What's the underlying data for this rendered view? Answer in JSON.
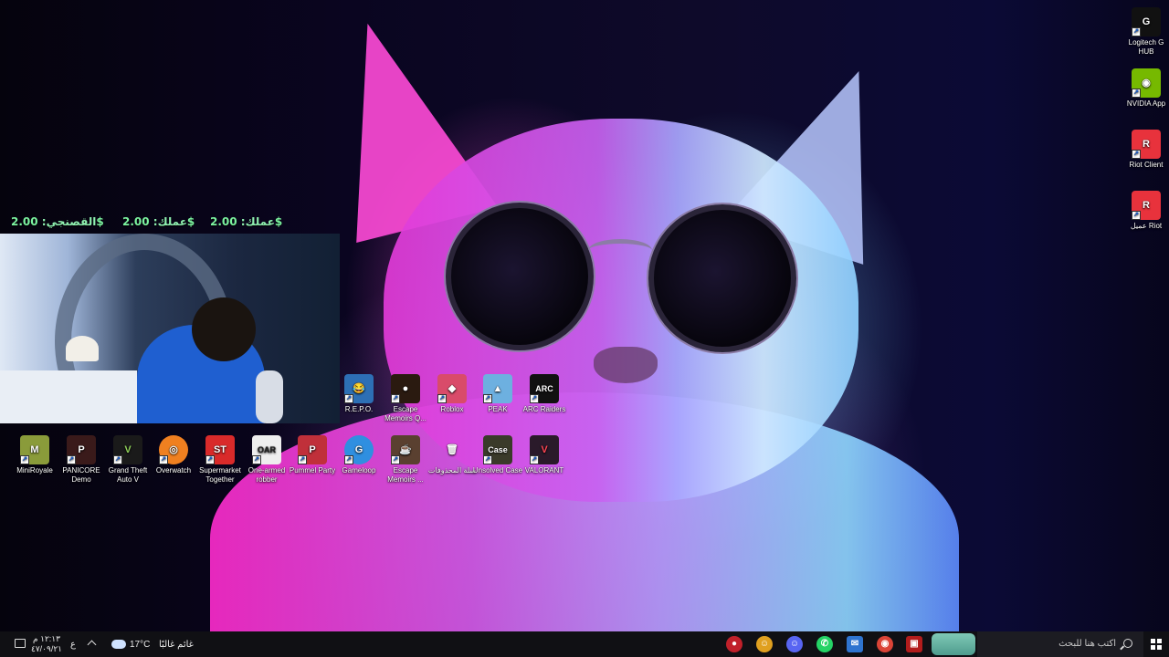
{
  "donations": [
    {
      "label": "عملك:",
      "amount": "2.00$"
    },
    {
      "label": "عملك:",
      "amount": "2.00$"
    },
    {
      "label": "القصنجي:",
      "amount": "2.00$"
    }
  ],
  "right_icons": [
    {
      "label": "Logitech G HUB",
      "icon": "logitech-icon",
      "color": "#111111"
    },
    {
      "label": "NVIDIA App",
      "icon": "nvidia-icon",
      "color": "#76b900"
    },
    {
      "label": "Riot Client",
      "icon": "riot-icon",
      "color": "#e8323c"
    },
    {
      "label": "عميل Riot",
      "icon": "riot-icon",
      "color": "#e8323c"
    }
  ],
  "icons_row1": [
    {
      "label": "R.E.P.O.",
      "glyph": "😂",
      "color": "#2d6fb5"
    },
    {
      "label": "Escape Memoirs Q...",
      "glyph": "●",
      "color": "#2a1a10"
    },
    {
      "label": "Roblox",
      "glyph": "◆",
      "color": "#d94b6a"
    },
    {
      "label": "PEAK",
      "glyph": "▲",
      "color": "#6db0e0"
    },
    {
      "label": "ARC Raiders",
      "glyph": "ARC",
      "color": "#111111"
    }
  ],
  "icons_row2": [
    {
      "label": "MiniRoyale",
      "glyph": "M",
      "color": "#8a9b3a"
    },
    {
      "label": "PANICORE Demo",
      "glyph": "P",
      "color": "#3a1a1a"
    },
    {
      "label": "Grand Theft Auto V",
      "glyph": "V",
      "color": "#1a1a1a"
    },
    {
      "label": "Overwatch",
      "glyph": "◎",
      "color": "#f08020"
    },
    {
      "label": "Supermarket Together",
      "glyph": "ST",
      "color": "#d92a2a"
    },
    {
      "label": "One-armed robber",
      "glyph": "OAR",
      "color": "#eeeeee"
    },
    {
      "label": "Pummel Party",
      "glyph": "P",
      "color": "#c0303a"
    },
    {
      "label": "Gameloop",
      "glyph": "G",
      "color": "#2f8fe0"
    },
    {
      "label": "Escape Memoirs ...",
      "glyph": "☕",
      "color": "#5a4030"
    },
    {
      "label": "سلة المحذوفات",
      "glyph": "🗑",
      "color": "#5aa0e0"
    },
    {
      "label": "Unsolved Case",
      "glyph": "Case",
      "color": "#3a3a2a"
    },
    {
      "label": "VALORANT",
      "glyph": "V",
      "color": "#2a1a2a"
    }
  ],
  "taskbar": {
    "search_placeholder": "اكتب هنا للبحث",
    "weather_temp": "17°C",
    "weather_desc": "غائم غالبًا",
    "lang": "ع",
    "time": "١٢:١٣ م",
    "date": "٤٧/٠٩/٢١",
    "apps": [
      {
        "name": "app-red-icon",
        "color": "#c0202a",
        "glyph": "●"
      },
      {
        "name": "discord-orange-icon",
        "color": "#e0a020",
        "glyph": "☺"
      },
      {
        "name": "discord-icon",
        "color": "#5865f2",
        "glyph": "☺"
      },
      {
        "name": "whatsapp-icon",
        "color": "#25d366",
        "glyph": "✆"
      },
      {
        "name": "mail-icon",
        "color": "#2f74d0",
        "glyph": "✉"
      },
      {
        "name": "chrome-icon",
        "color": "#db4437",
        "glyph": "◉"
      },
      {
        "name": "app-box-icon",
        "color": "#b21c1c",
        "glyph": "▣"
      }
    ]
  },
  "colors": {
    "donation_green": "#7cf3a0",
    "taskbar_bg": "#101014"
  }
}
